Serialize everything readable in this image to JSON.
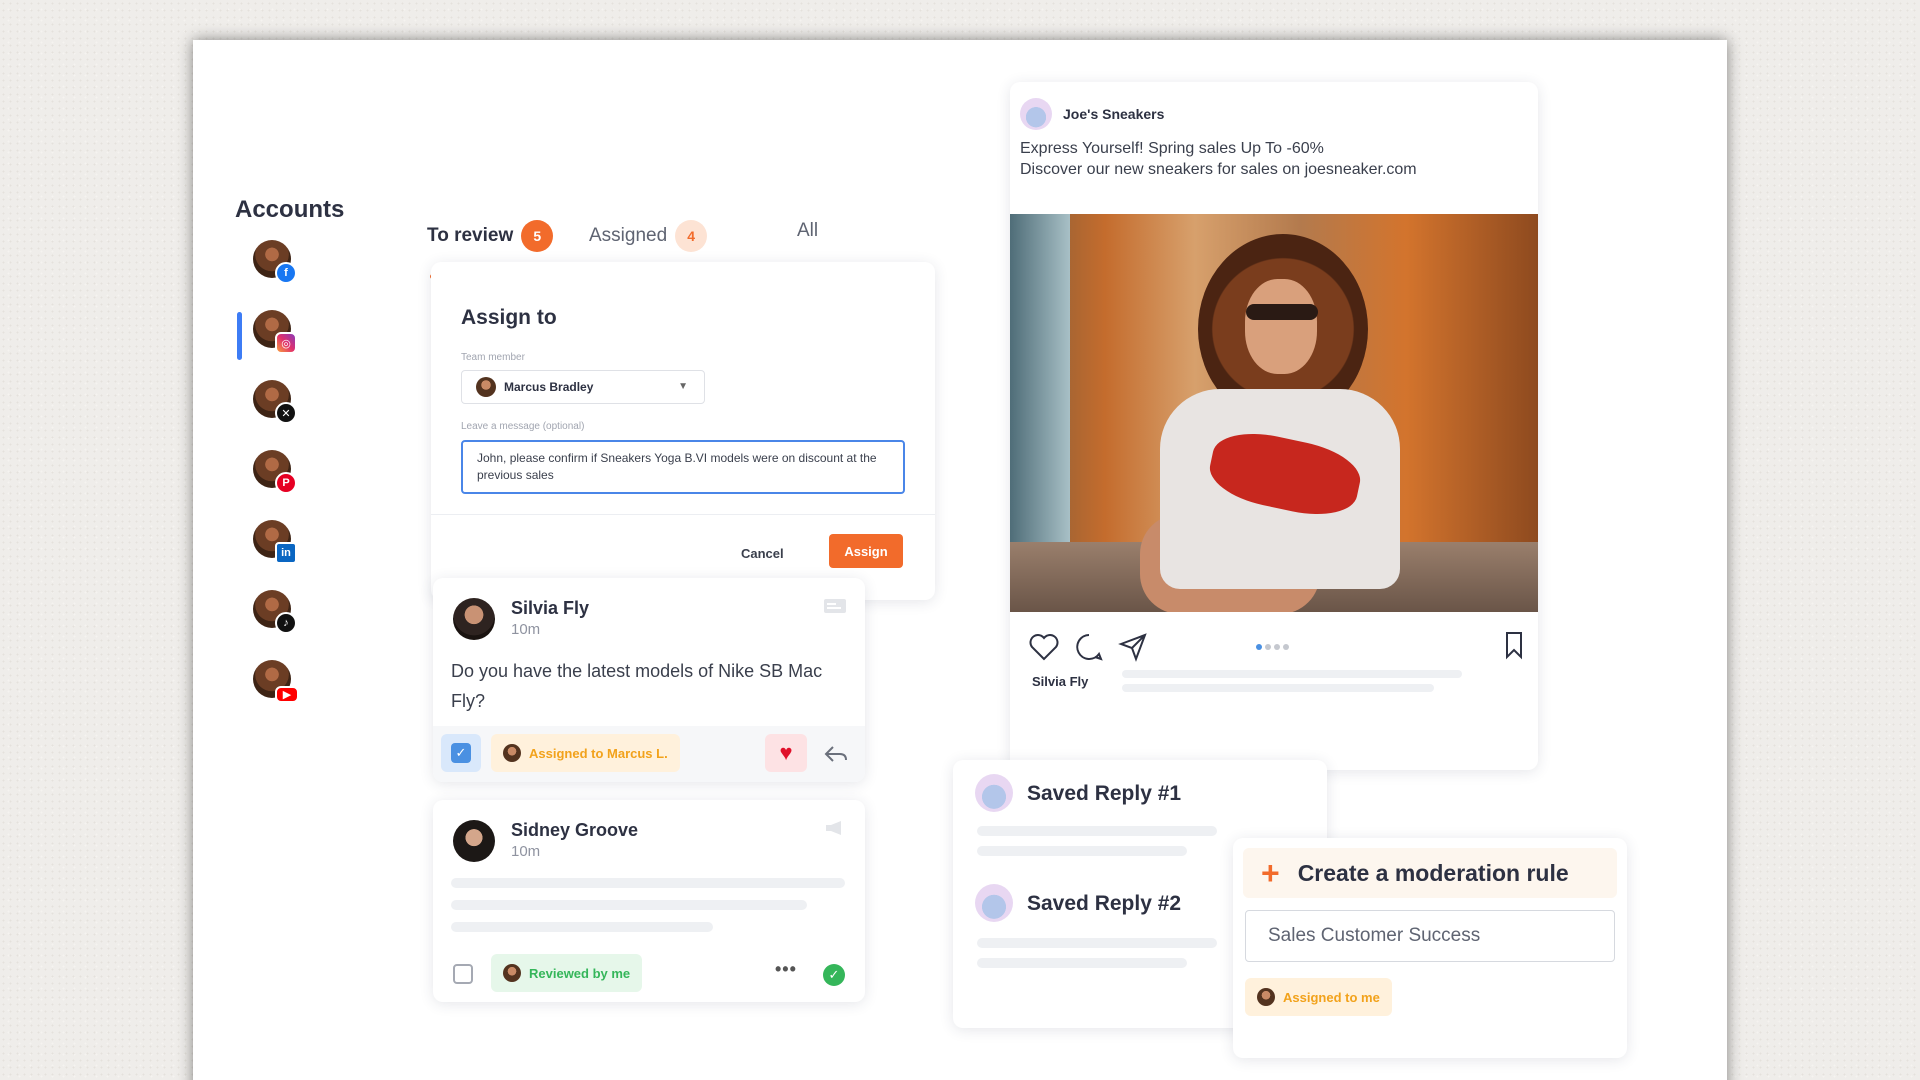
{
  "accounts": {
    "title": "Accounts",
    "items": [
      {
        "network": "facebook",
        "icon": "facebook-icon"
      },
      {
        "network": "instagram",
        "icon": "instagram-icon",
        "active": true
      },
      {
        "network": "x",
        "icon": "x-icon"
      },
      {
        "network": "pinterest",
        "icon": "pinterest-icon"
      },
      {
        "network": "linkedin",
        "icon": "linkedin-icon"
      },
      {
        "network": "tiktok",
        "icon": "tiktok-icon"
      },
      {
        "network": "youtube",
        "icon": "youtube-icon"
      }
    ]
  },
  "tabs": {
    "to_review": {
      "label": "To review",
      "count": "5"
    },
    "assigned": {
      "label": "Assigned",
      "count": "4"
    },
    "all": {
      "label": "All"
    }
  },
  "assign_card": {
    "title": "Assign to",
    "team_member_label": "Team member",
    "team_member_value": "Marcus Bradley",
    "message_label": "Leave a message (optional)",
    "message_value": "John, please confirm if Sneakers Yoga B.VI models were on discount at the previous sales",
    "cancel_label": "Cancel",
    "assign_label": "Assign"
  },
  "comments": [
    {
      "author": "Silvia Fly",
      "time": "10m",
      "text": "Do you have the latest models of Nike SB Mac Fly?",
      "tag": "Assigned to Marcus L.",
      "checked": true
    },
    {
      "author": "Sidney Groove",
      "time": "10m",
      "tag": "Reviewed by me",
      "checked": false
    }
  ],
  "post": {
    "brand": "Joe's Sneakers",
    "caption_line1": "Express Yourself! Spring sales Up To -60%",
    "caption_line2": "Discover our new sneakers for sales on joesneaker.com",
    "liked_by": "Silvia Fly"
  },
  "saved_replies": [
    {
      "title": "Saved Reply #1"
    },
    {
      "title": "Saved Reply #2"
    }
  ],
  "moderation": {
    "title": "Create a moderation rule",
    "input_value": "Sales Customer Success",
    "tag": "Assigned to me"
  },
  "colors": {
    "accent": "#f26b2b",
    "active_indicator": "#3d7cf5",
    "assigned_tag": "#f2a21b",
    "reviewed_tag": "#35b65a",
    "like": "#e0102a"
  }
}
